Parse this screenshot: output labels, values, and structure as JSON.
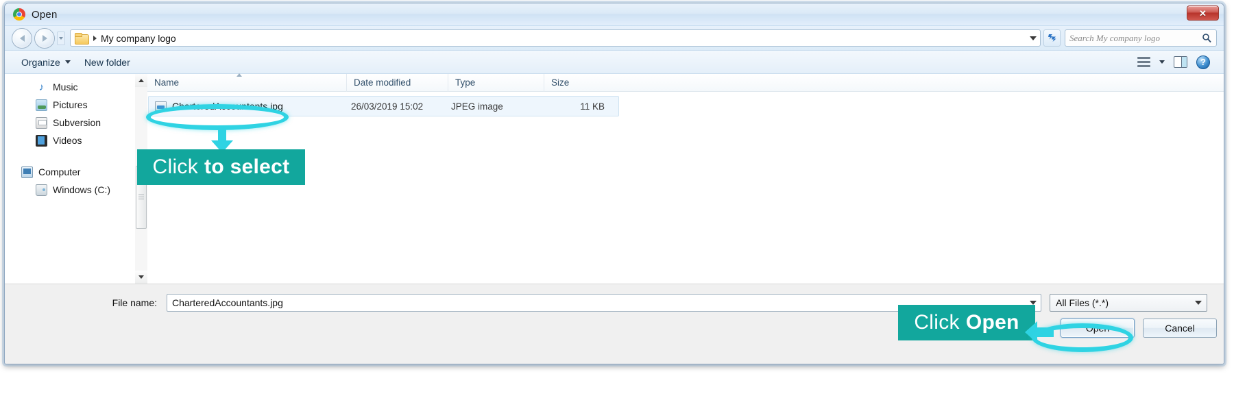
{
  "window": {
    "title": "Open",
    "app_icon": "chrome-logo-icon",
    "close_label": "✕"
  },
  "navigation": {
    "back_icon": "back-arrow-icon",
    "forward_icon": "forward-arrow-icon",
    "recent_icon": "chevron-down-icon",
    "address": {
      "folder_icon": "folder-icon",
      "crumb": "My company logo",
      "dropdown_icon": "chevron-down-icon"
    },
    "refresh_icon": "refresh-icon",
    "search": {
      "placeholder": "Search My company logo",
      "icon": "search-icon"
    }
  },
  "toolbar": {
    "organize_label": "Organize",
    "new_folder_label": "New folder",
    "views_icon": "view-options-icon",
    "views_caret_icon": "chevron-down-icon",
    "preview_pane_icon": "preview-pane-icon",
    "help_icon": "help-icon",
    "help_glyph": "?"
  },
  "sidebar": {
    "items": [
      {
        "label": "Music",
        "icon": "music-icon",
        "indent": "child"
      },
      {
        "label": "Pictures",
        "icon": "pictures-icon",
        "indent": "child"
      },
      {
        "label": "Subversion",
        "icon": "subversion-icon",
        "indent": "child"
      },
      {
        "label": "Videos",
        "icon": "videos-icon",
        "indent": "child"
      },
      {
        "label": "Computer",
        "icon": "computer-icon",
        "indent": "root"
      },
      {
        "label": "Windows (C:)",
        "icon": "drive-icon",
        "indent": "child"
      }
    ]
  },
  "file_list": {
    "columns": [
      "Name",
      "Date modified",
      "Type",
      "Size"
    ],
    "rows": [
      {
        "name": "CharteredAccountants.jpg",
        "date_modified": "26/03/2019 15:02",
        "type": "JPEG image",
        "size": "11 KB",
        "icon": "jpeg-file-icon",
        "selected": true
      }
    ]
  },
  "footer": {
    "file_name_label": "File name:",
    "file_name_value": "CharteredAccountants.jpg",
    "file_name_dropdown_icon": "chevron-down-icon",
    "file_type_value": "All Files (*.*)",
    "file_type_dropdown_icon": "chevron-down-icon",
    "open_label": "Open",
    "cancel_label": "Cancel"
  },
  "annotations": {
    "accent_teal": "#12a79d",
    "accent_cyan": "#2fd3e3",
    "select_callout": {
      "plain": "Click",
      "bold": "to select"
    },
    "open_callout": {
      "plain": "Click",
      "bold": "Open"
    },
    "arrow_down_icon": "down-arrow-annotation",
    "arrow_left_icon": "left-arrow-annotation",
    "highlight_file_icon": "ellipse-highlight",
    "highlight_open_icon": "ellipse-highlight"
  }
}
